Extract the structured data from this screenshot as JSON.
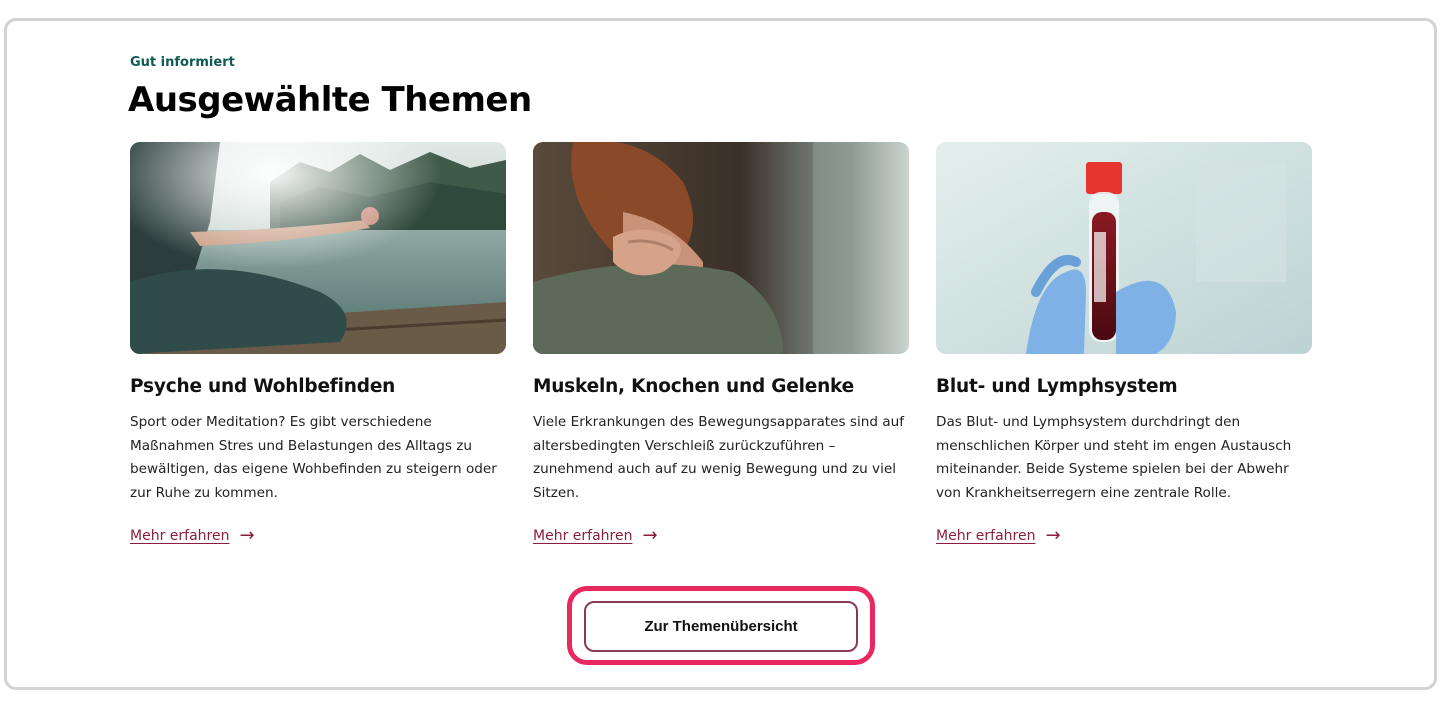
{
  "section": {
    "eyebrow": "Gut informiert",
    "title": "Ausgewählte Themen"
  },
  "cards": [
    {
      "image_alt": "Person meditating on a wooden dock by a lake",
      "title": "Psyche und Wohlbefinden",
      "text": "Sport oder Meditation? Es gibt verschiedene Maßnahmen Stres und Belastungen des Alltags zu bewältigen, das eigene Wohbefinden zu steigern oder zur Ruhe zu kommen.",
      "link_label": "Mehr erfahren",
      "link_icon": "arrow-right-icon"
    },
    {
      "image_alt": "Woman holding her neck with one hand",
      "title": "Muskeln, Knochen und Gelenke",
      "text": "Viele Erkrankungen des Bewegungsapparates sind auf altersbedingten Verschleiß zurückzuführen – zunehmend auch auf zu wenig Bewegung und zu viel Sitzen.",
      "link_label": "Mehr erfahren",
      "link_icon": "arrow-right-icon"
    },
    {
      "image_alt": "Gloved hand holding a blood sample tube",
      "title": "Blut- und Lymphsystem",
      "text": "Das Blut- und Lymphsystem durchdringt den menschlichen Körper und steht im engen Austausch miteinander. Beide Systeme spielen bei der Abwehr von Krankheitserregern eine zentrale Rolle.",
      "link_label": "Mehr erfahren",
      "link_icon": "arrow-right-icon"
    }
  ],
  "cta": {
    "label": "Zur Themenübersicht"
  },
  "colors": {
    "eyebrow": "#0f5a52",
    "link": "#8a1f3c",
    "highlight": "#e8285e",
    "frame": "#d2d2d2"
  }
}
